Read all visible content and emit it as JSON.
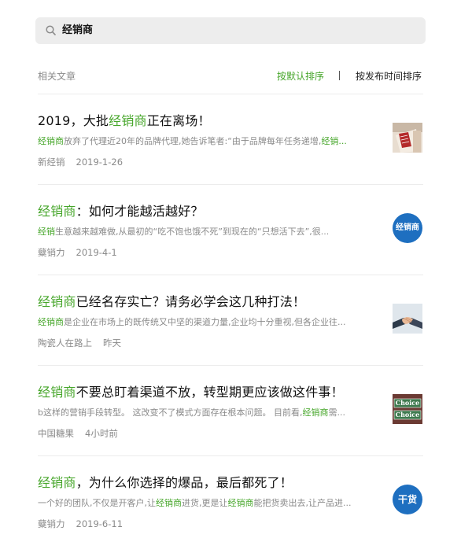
{
  "search": {
    "query": "经销商",
    "icon": "search-icon"
  },
  "section": {
    "title": "相关文章",
    "sort_default": "按默认排序",
    "sort_time": "按发布时间排序"
  },
  "colors": {
    "highlight": "#46a62a",
    "meta": "#8a8a8a",
    "search_bg": "#ededed"
  },
  "articles": [
    {
      "title_parts": [
        "2019，大批",
        "经销商",
        "正在离场！"
      ],
      "snippet_parts": [
        "经销商",
        "放弃了代理近20年的品牌代理,她告诉笔者:“由于品牌每年任务递增,",
        "经销..."
      ],
      "source": "新经销",
      "date": "2019-1-26",
      "thumb": "photo-ledger-thumbnail"
    },
    {
      "title_parts": [
        "经销商",
        "：如何才能越活越好？"
      ],
      "snippet_parts": [
        "经销",
        "生意越来越难做,从最初的“吃不饱也饿不死”到现在的“只想活下去”,很..."
      ],
      "source": "糵销力",
      "date": "2019-4-1",
      "thumb": "logo-circle-thumbnail",
      "thumb_text": "经销商"
    },
    {
      "title_parts": [
        "经销商",
        "已经名存实亡？请务必学会这几种打法！"
      ],
      "snippet_parts": [
        "经销商",
        "是企业在市场上的既传统又中坚的渠道力量,企业均十分重视,但各企业往..."
      ],
      "source": "陶瓷人在路上",
      "date": "昨天",
      "thumb": "handshake-thumbnail"
    },
    {
      "title_parts": [
        "经销商",
        "不要总盯着渠道不放，转型期更应该做这件事！"
      ],
      "snippet_parts": [
        "b这样的营销手段转型。 这改变不了模式方面存在根本问题。 目前看,",
        "经销商",
        "需..."
      ],
      "source": "中国糖果",
      "date": "4小时前",
      "thumb": "choice-signs-thumbnail",
      "thumb_text_1": "Choice",
      "thumb_text_2": "Choice"
    },
    {
      "title_parts": [
        "经销商",
        "，为什么你选择的爆品，最后都死了！"
      ],
      "snippet_parts": [
        "一个好的团队,不仅是开客户,让",
        "经销商",
        "进货,更是让",
        "经销商",
        "能把货卖出去,让产品进..."
      ],
      "source": "糵销力",
      "date": "2019-6-11",
      "thumb": "logo-circle-thumbnail",
      "thumb_text": "干货"
    }
  ]
}
